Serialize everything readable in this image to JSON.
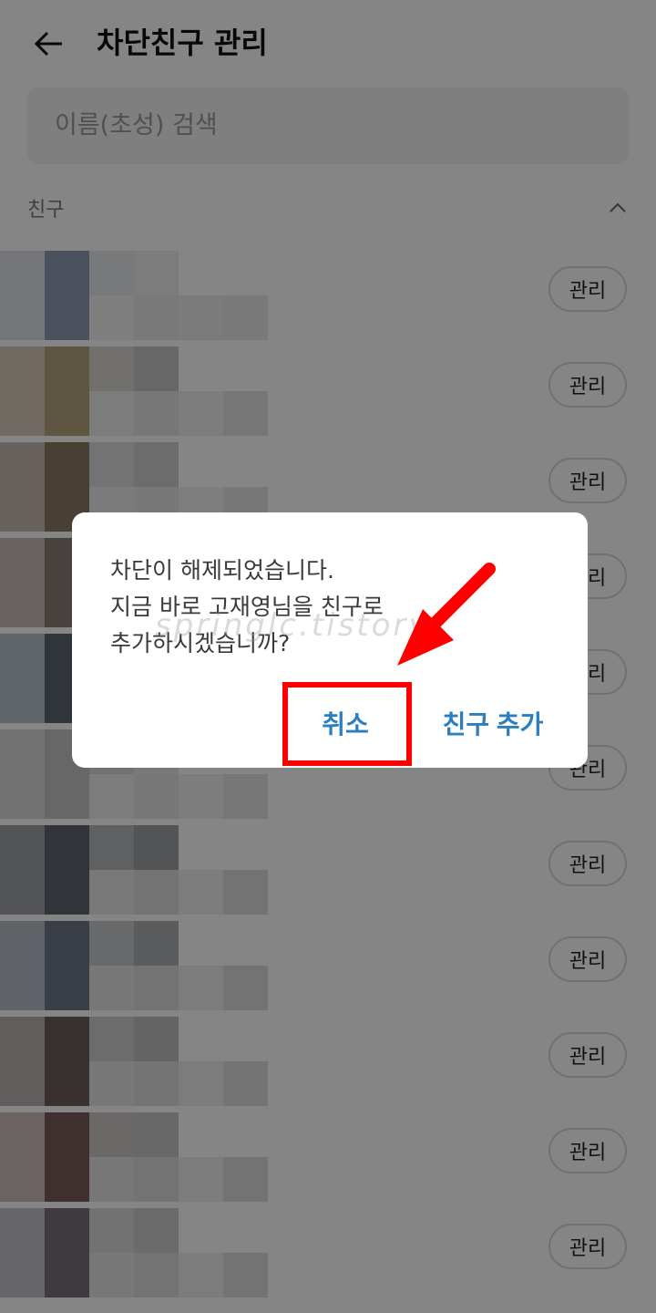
{
  "header": {
    "title": "차단친구 관리",
    "back_icon": "arrow-left-icon"
  },
  "search": {
    "placeholder": "이름(초성) 검색"
  },
  "friends_section": {
    "label": "친구",
    "toggle_icon": "chevron-up-icon"
  },
  "friends": [
    {
      "action_label": "관리"
    },
    {
      "action_label": "관리"
    },
    {
      "action_label": "관리"
    },
    {
      "action_label": "관리"
    },
    {
      "action_label": "관리"
    },
    {
      "action_label": "관리"
    },
    {
      "action_label": "관리"
    },
    {
      "action_label": "관리"
    },
    {
      "action_label": "관리"
    },
    {
      "action_label": "관리"
    },
    {
      "action_label": "관리"
    }
  ],
  "dialog": {
    "message_lines": [
      "차단이 해제되었습니다.",
      "지금 바로 고재영님을 친구로",
      "추가하시겠습니까?"
    ],
    "cancel_label": "취소",
    "confirm_label": "친구 추가"
  },
  "annotation": {
    "highlight_color": "#ff0000"
  },
  "watermark": "springlc.tistory"
}
